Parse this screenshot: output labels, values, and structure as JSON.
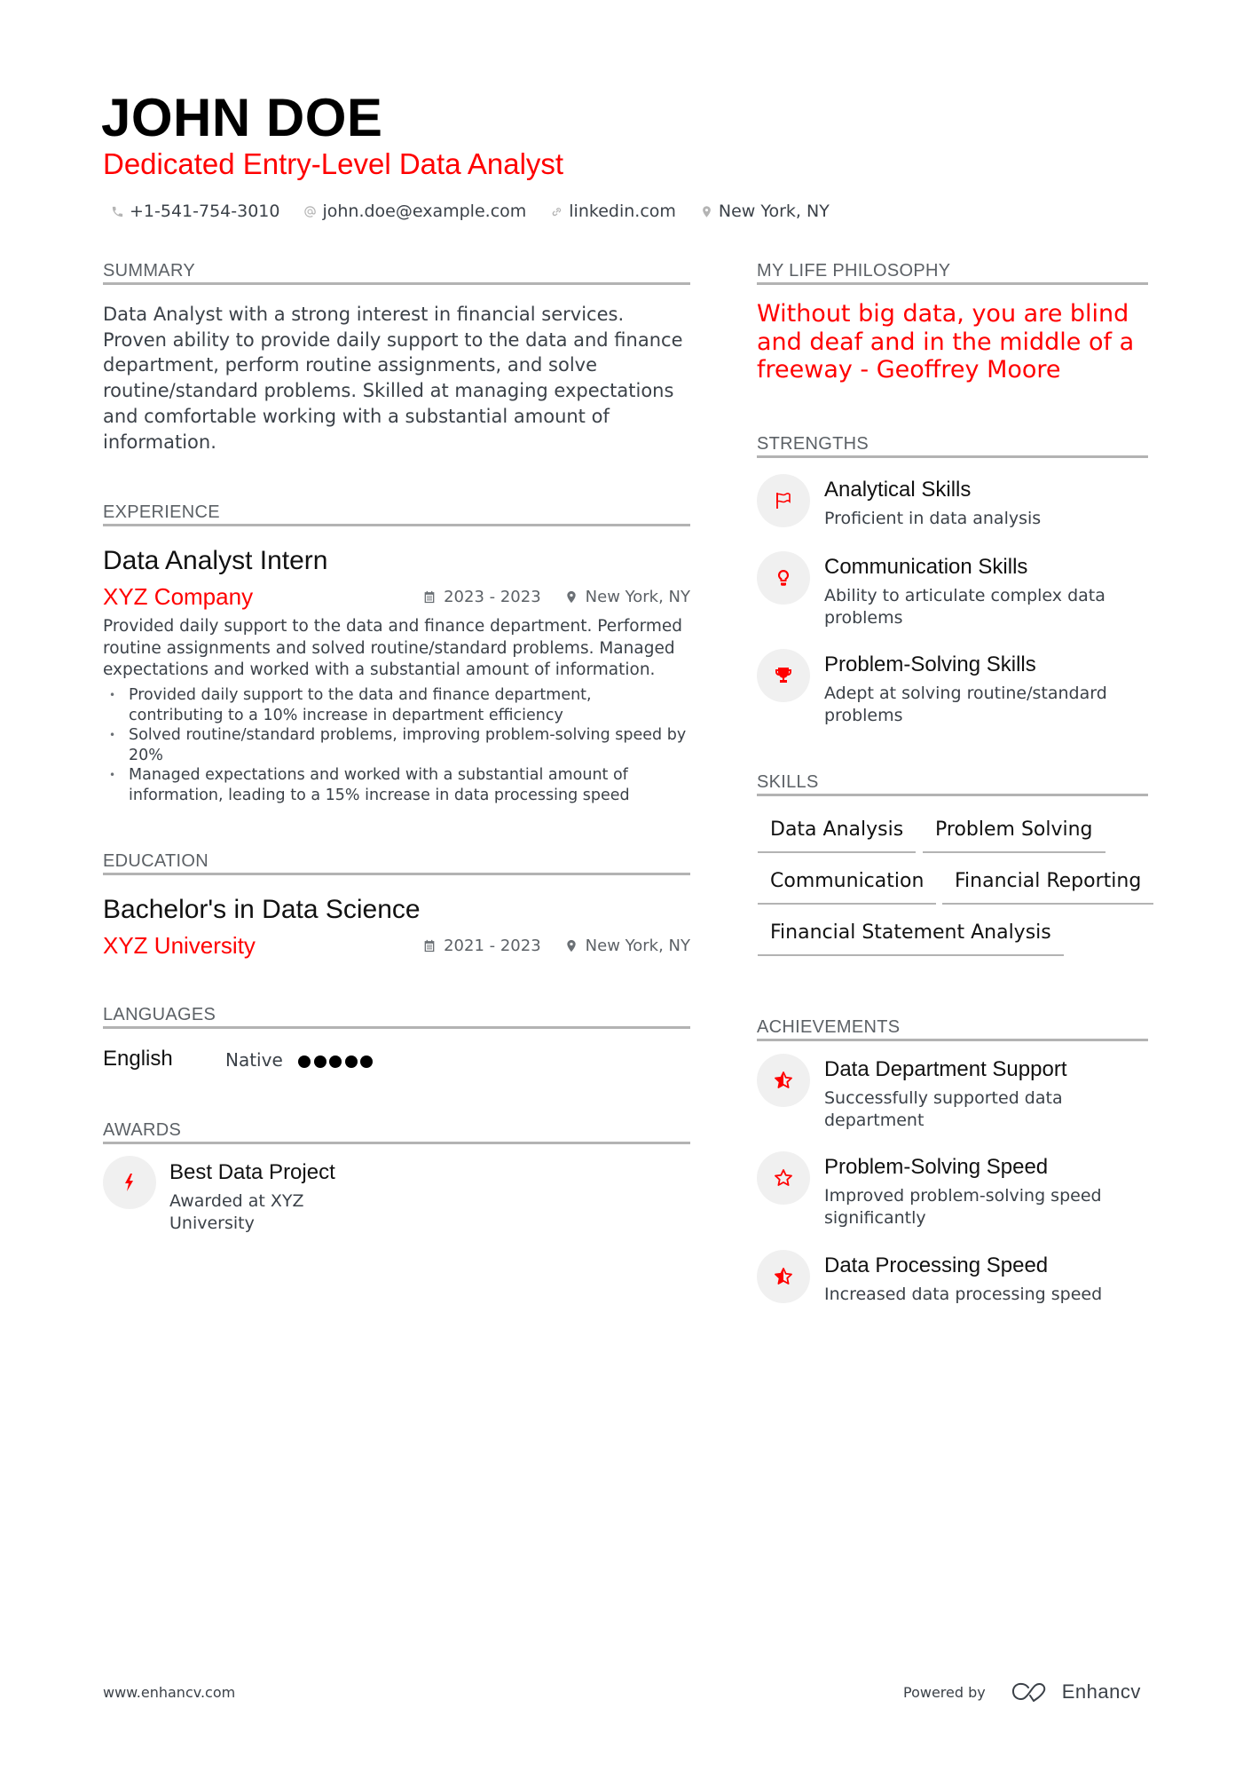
{
  "header": {
    "name": "JOHN DOE",
    "title": "Dedicated Entry-Level Data Analyst",
    "contacts": [
      {
        "icon": "phone-icon",
        "text": "+1-541-754-3010"
      },
      {
        "icon": "at-icon",
        "text": "john.doe@example.com"
      },
      {
        "icon": "link-icon",
        "text": "linkedin.com"
      },
      {
        "icon": "location-icon",
        "text": "New York, NY"
      }
    ]
  },
  "summary": {
    "heading": "SUMMARY",
    "text": "Data Analyst with a strong interest in financial services. Proven ability to provide daily support to the data and finance department, perform routine assignments, and solve routine/standard problems. Skilled at managing expectations and comfortable working with a substantial amount of information."
  },
  "experience": {
    "heading": "EXPERIENCE",
    "items": [
      {
        "title": "Data Analyst Intern",
        "company": "XYZ Company",
        "dates": "2023 - 2023",
        "location": "New York, NY",
        "description": "Provided daily support to the data and finance department. Performed routine assignments and solved routine/standard problems. Managed expectations and worked with a substantial amount of information.",
        "bullets": [
          "Provided daily support to the data and finance department, contributing to a 10% increase in department efficiency",
          "Solved routine/standard problems, improving problem-solving speed by 20%",
          "Managed expectations and worked with a substantial amount of information, leading to a 15% increase in data processing speed"
        ]
      }
    ]
  },
  "education": {
    "heading": "EDUCATION",
    "items": [
      {
        "degree": "Bachelor's in Data Science",
        "school": "XYZ University",
        "dates": "2021 - 2023",
        "location": "New York, NY"
      }
    ]
  },
  "languages": {
    "heading": "LANGUAGES",
    "items": [
      {
        "name": "English",
        "level": "Native",
        "rating": 5,
        "rating_max": 5
      }
    ]
  },
  "awards": {
    "heading": "AWARDS",
    "items": [
      {
        "icon": "bolt-icon",
        "title": "Best Data Project",
        "description": "Awarded at XYZ University"
      }
    ]
  },
  "philosophy": {
    "heading": "MY LIFE PHILOSOPHY",
    "quote": "Without big data, you are blind and deaf and in the middle of a freeway - Geoffrey Moore"
  },
  "strengths": {
    "heading": "STRENGTHS",
    "items": [
      {
        "icon": "flag-icon",
        "title": "Analytical Skills",
        "description": "Proficient in data analysis"
      },
      {
        "icon": "lightbulb-icon",
        "title": "Communication Skills",
        "description": "Ability to articulate complex data problems"
      },
      {
        "icon": "trophy-icon",
        "title": "Problem-Solving Skills",
        "description": "Adept at solving routine/standard problems"
      }
    ]
  },
  "skills": {
    "heading": "SKILLS",
    "items": [
      "Data Analysis",
      "Problem Solving",
      "Communication",
      "Financial Reporting",
      "Financial Statement Analysis"
    ]
  },
  "achievements": {
    "heading": "ACHIEVEMENTS",
    "items": [
      {
        "icon": "star-half-icon",
        "title": "Data Department Support",
        "description": "Successfully supported data department"
      },
      {
        "icon": "star-outline-icon",
        "title": "Problem-Solving Speed",
        "description": "Improved problem-solving speed significantly"
      },
      {
        "icon": "star-half-icon",
        "title": "Data Processing Speed",
        "description": "Increased data processing speed"
      }
    ]
  },
  "footer": {
    "website": "www.enhancv.com",
    "powered_by": "Powered by",
    "brand": "Enhancv"
  },
  "colors": {
    "accent": "#ff0000",
    "text": "#111111",
    "muted": "#3b4148",
    "rule": "#b3b3b3",
    "icon_bg": "#f0f0f0"
  }
}
